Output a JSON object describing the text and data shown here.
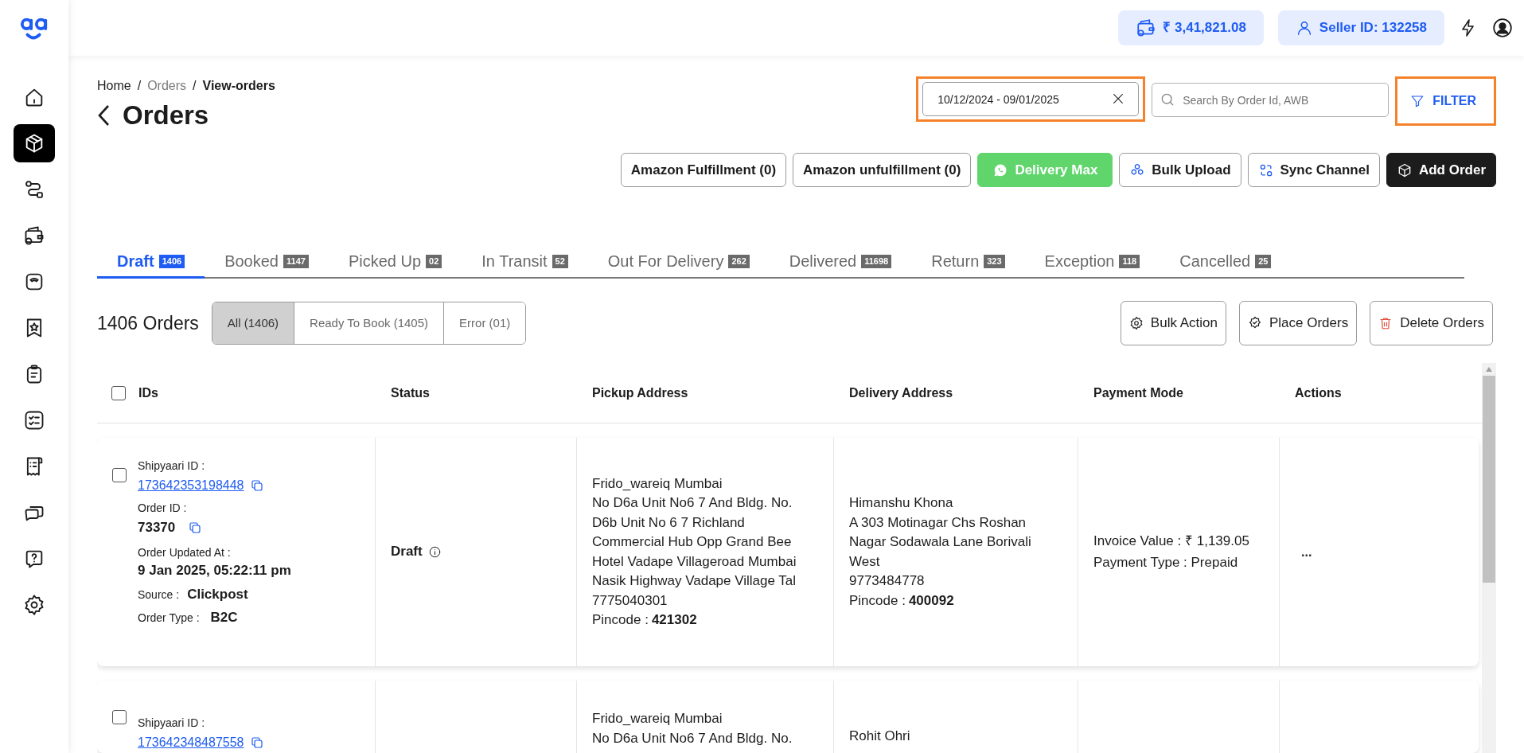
{
  "sidebar": {
    "items": [
      {
        "kind": "home",
        "selected": false
      },
      {
        "kind": "box",
        "selected": true
      },
      {
        "kind": "route",
        "selected": false
      },
      {
        "kind": "wallet",
        "selected": false
      },
      {
        "kind": "scale",
        "selected": false
      },
      {
        "kind": "bookmark",
        "selected": false
      },
      {
        "kind": "clipboard",
        "selected": false
      },
      {
        "kind": "checklist",
        "selected": false
      },
      {
        "kind": "receipt",
        "selected": false
      },
      {
        "kind": "chat",
        "selected": false
      },
      {
        "kind": "help",
        "selected": false
      },
      {
        "kind": "settings",
        "selected": false
      }
    ]
  },
  "header": {
    "wallet_balance": "₹ 3,41,821.08",
    "seller_id": "Seller ID: 132258"
  },
  "breadcrumb": [
    {
      "kind": "link",
      "text": "Home"
    },
    {
      "kind": "separator",
      "text": "/"
    },
    {
      "kind": "muted",
      "text": "Orders"
    },
    {
      "kind": "separator",
      "text": "/"
    },
    {
      "kind": "current",
      "text": "View-orders"
    }
  ],
  "title": "Orders",
  "date_range": {
    "value": "10/12/2024 - 09/01/2025",
    "highlighted": true
  },
  "search": {
    "placeholder": "Search By Order Id, AWB"
  },
  "filter": {
    "label": "FILTER",
    "highlighted": true
  },
  "action_buttons": [
    {
      "label": "Amazon Fulfillment (0)",
      "kind": "outline"
    },
    {
      "label": "Amazon unfulfillment (0)",
      "kind": "outline"
    },
    {
      "label": "Delivery Max",
      "kind": "whatsapp"
    },
    {
      "label": "Bulk Upload",
      "kind": "upload"
    },
    {
      "label": "Sync Channel",
      "kind": "sync"
    },
    {
      "label": "Add Order",
      "kind": "primary"
    }
  ],
  "tabs": [
    {
      "label": "Draft",
      "count": "1406",
      "selected": true
    },
    {
      "label": "Booked",
      "count": "1147",
      "selected": false
    },
    {
      "label": "Picked Up",
      "count": "02",
      "selected": false
    },
    {
      "label": "In Transit",
      "count": "52",
      "selected": false
    },
    {
      "label": "Out For Delivery",
      "count": "262",
      "selected": false
    },
    {
      "label": "Delivered",
      "count": "11698",
      "selected": false
    },
    {
      "label": "Return",
      "count": "323",
      "selected": false
    },
    {
      "label": "Exception",
      "count": "118",
      "selected": false
    },
    {
      "label": "Cancelled",
      "count": "25",
      "selected": false
    }
  ],
  "orders_count": "1406 Orders",
  "subfilters": [
    {
      "label": "All (1406)",
      "selected": true
    },
    {
      "label": "Ready To Book (1405)",
      "selected": false
    },
    {
      "label": "Error (01)",
      "selected": false
    }
  ],
  "bulk_buttons": [
    {
      "label": "Bulk Action",
      "kind": "gear"
    },
    {
      "label": "Place Orders",
      "kind": "check"
    },
    {
      "label": "Delete Orders",
      "kind": "delete"
    }
  ],
  "table": {
    "select_all_checked": false,
    "columns": [
      "IDs",
      "Status",
      "Pickup Address",
      "Delivery Address",
      "Payment Mode",
      "Actions"
    ],
    "rows": [
      {
        "checked": false,
        "shipyaari_id_label": "Shipyaari ID :",
        "shipyaari_id": "173642353198448",
        "order_id_label": "Order ID :",
        "order_id": "73370",
        "updated_label": "Order Updated At :",
        "updated_at": "9 Jan 2025, 05:22:11 pm",
        "source_label": "Source :",
        "source": "Clickpost",
        "type_label": "Order Type :",
        "order_type": "B2C",
        "status": "Draft",
        "pickup": {
          "lines": [
            "Frido_wareiq Mumbai",
            "No D6a Unit No6 7 And Bldg. No.",
            "D6b Unit No 6 7 Richland",
            "Commercial Hub Opp Grand Bee",
            "Hotel Vadape Villageroad Mumbai",
            "Nasik Highway Vadape Village Tal",
            "7775040301"
          ],
          "pincode_label": "Pincode :",
          "pincode": "421302"
        },
        "delivery": {
          "lines": [
            "Himanshu Khona",
            "A 303 Motinagar Chs Roshan",
            "Nagar Sodawala Lane Borivali",
            "West",
            "9773484778"
          ],
          "pincode_label": "Pincode :",
          "pincode": "400092"
        },
        "invoice": "Invoice Value : ₹ 1,139.05",
        "payment_type": "Payment Type : Prepaid",
        "actions": "..."
      },
      {
        "checked": false,
        "shipyaari_id_label": "Shipyaari ID :",
        "shipyaari_id": "173642348487558",
        "pickup": {
          "lines": [
            "Frido_wareiq Mumbai",
            "No D6a Unit No6 7 And Bldg. No."
          ]
        },
        "delivery": {
          "lines": [
            "Rohit Ohri"
          ]
        }
      }
    ]
  }
}
